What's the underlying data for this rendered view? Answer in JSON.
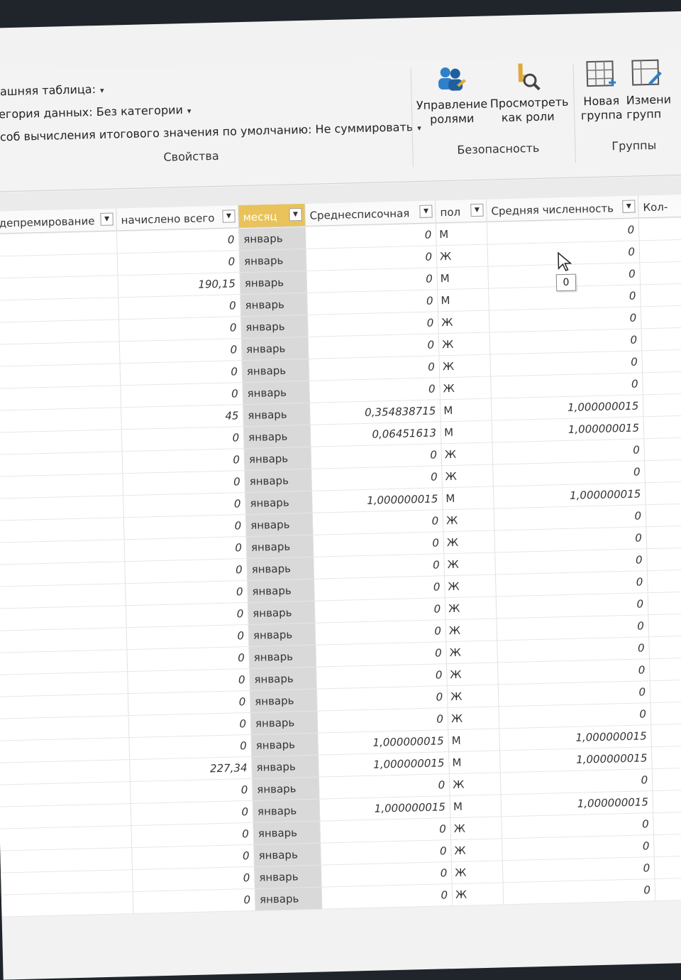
{
  "properties": {
    "home_table": "омашняя таблица:",
    "data_category": "атегория данных: Без категории",
    "summarize": "пособ вычисления итогового значения по умолчанию: Не суммировать",
    "group_label": "Свойства"
  },
  "security": {
    "manage_roles": [
      "Управление",
      "ролями"
    ],
    "view_as_roles": [
      "Просмотреть",
      "как роли"
    ],
    "group_label": "Безопасность"
  },
  "groups": {
    "new_group": [
      "Новая",
      "группа"
    ],
    "edit_group": [
      "Измени",
      "групп"
    ],
    "group_label": "Группы"
  },
  "table": {
    "columns": [
      {
        "label": "б депремирование",
        "selected": false
      },
      {
        "label": "начислено всего",
        "selected": false
      },
      {
        "label": "месяц",
        "selected": true
      },
      {
        "label": "Среднесписочная",
        "selected": false
      },
      {
        "label": "пол",
        "selected": false
      },
      {
        "label": "Средняя численность",
        "selected": false
      },
      {
        "label": "Кол-",
        "selected": false
      }
    ],
    "rows": [
      [
        "0",
        "январь",
        "0",
        "М",
        "0"
      ],
      [
        "0",
        "январь",
        "0",
        "Ж",
        "0"
      ],
      [
        "190,15",
        "январь",
        "0",
        "М",
        "0"
      ],
      [
        "0",
        "январь",
        "0",
        "М",
        "0"
      ],
      [
        "0",
        "январь",
        "0",
        "Ж",
        "0"
      ],
      [
        "0",
        "январь",
        "0",
        "Ж",
        "0"
      ],
      [
        "0",
        "январь",
        "0",
        "Ж",
        "0"
      ],
      [
        "0",
        "январь",
        "0",
        "Ж",
        "0"
      ],
      [
        "45",
        "январь",
        "0,354838715",
        "М",
        "1,000000015"
      ],
      [
        "0",
        "январь",
        "0,06451613",
        "М",
        "1,000000015"
      ],
      [
        "0",
        "январь",
        "0",
        "Ж",
        "0"
      ],
      [
        "0",
        "январь",
        "0",
        "Ж",
        "0"
      ],
      [
        "0",
        "январь",
        "1,000000015",
        "М",
        "1,000000015"
      ],
      [
        "0",
        "январь",
        "0",
        "Ж",
        "0"
      ],
      [
        "0",
        "январь",
        "0",
        "Ж",
        "0"
      ],
      [
        "0",
        "январь",
        "0",
        "Ж",
        "0"
      ],
      [
        "0",
        "январь",
        "0",
        "Ж",
        "0"
      ],
      [
        "0",
        "январь",
        "0",
        "Ж",
        "0"
      ],
      [
        "0",
        "январь",
        "0",
        "Ж",
        "0"
      ],
      [
        "0",
        "январь",
        "0",
        "Ж",
        "0"
      ],
      [
        "0",
        "январь",
        "0",
        "Ж",
        "0"
      ],
      [
        "0",
        "январь",
        "0",
        "Ж",
        "0"
      ],
      [
        "0",
        "январь",
        "0",
        "Ж",
        "0"
      ],
      [
        "0",
        "январь",
        "1,000000015",
        "М",
        "1,000000015"
      ],
      [
        "227,34",
        "январь",
        "1,000000015",
        "М",
        "1,000000015"
      ],
      [
        "0",
        "январь",
        "0",
        "Ж",
        "0"
      ],
      [
        "0",
        "январь",
        "1,000000015",
        "М",
        "1,000000015"
      ],
      [
        "0",
        "январь",
        "0",
        "Ж",
        "0"
      ],
      [
        "0",
        "январь",
        "0",
        "Ж",
        "0"
      ],
      [
        "0",
        "январь",
        "0",
        "Ж",
        "0"
      ],
      [
        "0",
        "январь",
        "0",
        "Ж",
        "0"
      ]
    ]
  },
  "tooltip": {
    "value": "0"
  },
  "colors": {
    "selected_header": "#e9c35a",
    "month_column": "#d9d9d9"
  }
}
